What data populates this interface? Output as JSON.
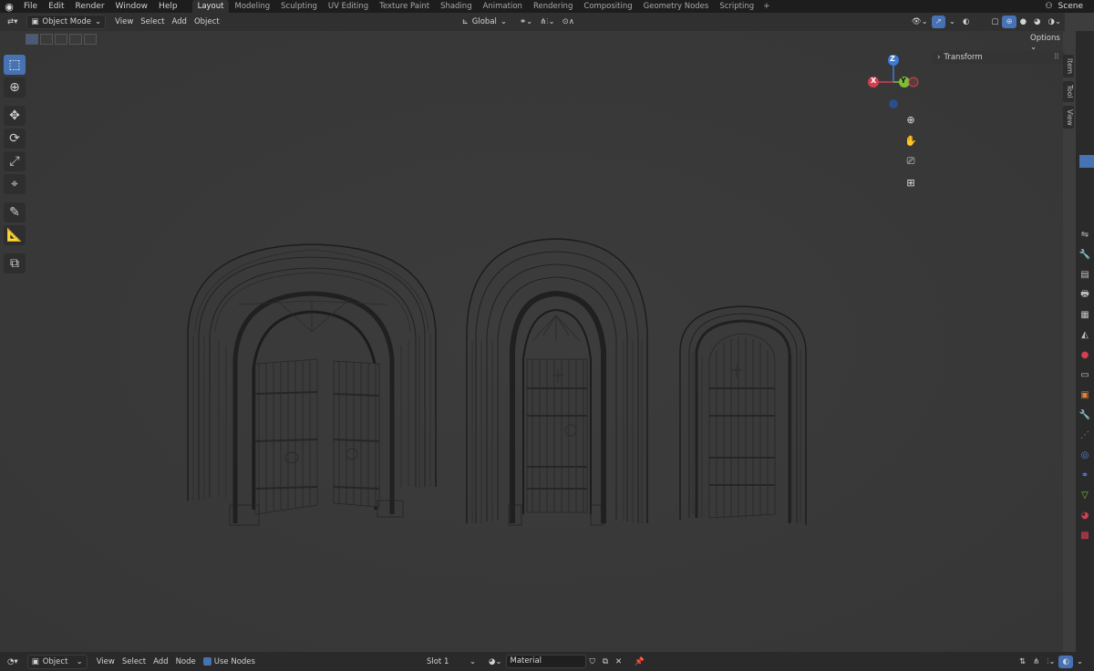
{
  "topbar": {
    "menu": [
      "File",
      "Edit",
      "Render",
      "Window",
      "Help"
    ],
    "tabs": [
      "Layout",
      "Modeling",
      "Sculpting",
      "UV Editing",
      "Texture Paint",
      "Shading",
      "Animation",
      "Rendering",
      "Compositing",
      "Geometry Nodes",
      "Scripting"
    ],
    "active_tab": "Layout",
    "scene": "Scene"
  },
  "header": {
    "mode": "Object Mode",
    "menus": [
      "View",
      "Select",
      "Add",
      "Object"
    ],
    "transform_orientation": "Global",
    "options": "Options"
  },
  "sidebar": {
    "tabs": [
      "Item",
      "Tool",
      "View"
    ],
    "panel_title": "Transform"
  },
  "gizmo": {
    "x": "X",
    "y": "Y",
    "z": "Z"
  },
  "bottombar": {
    "editor_mode": "Object",
    "menus": [
      "View",
      "Select",
      "Add",
      "Node"
    ],
    "use_nodes_label": "Use Nodes",
    "slot": "Slot 1",
    "material": "Material"
  },
  "colors": {
    "accent": "#4772b3",
    "x_axis": "#d33f50",
    "y_axis": "#7fbf38",
    "z_axis": "#3a7cd8"
  },
  "icons": [
    "blender-logo-icon",
    "select-box-icon",
    "cursor-icon",
    "move-icon",
    "rotate-icon",
    "scale-icon",
    "transform-icon",
    "annotate-icon",
    "measure-icon",
    "add-cube-icon",
    "zoom-icon",
    "hand-pan-icon",
    "camera-icon",
    "grid-perspective-icon"
  ]
}
